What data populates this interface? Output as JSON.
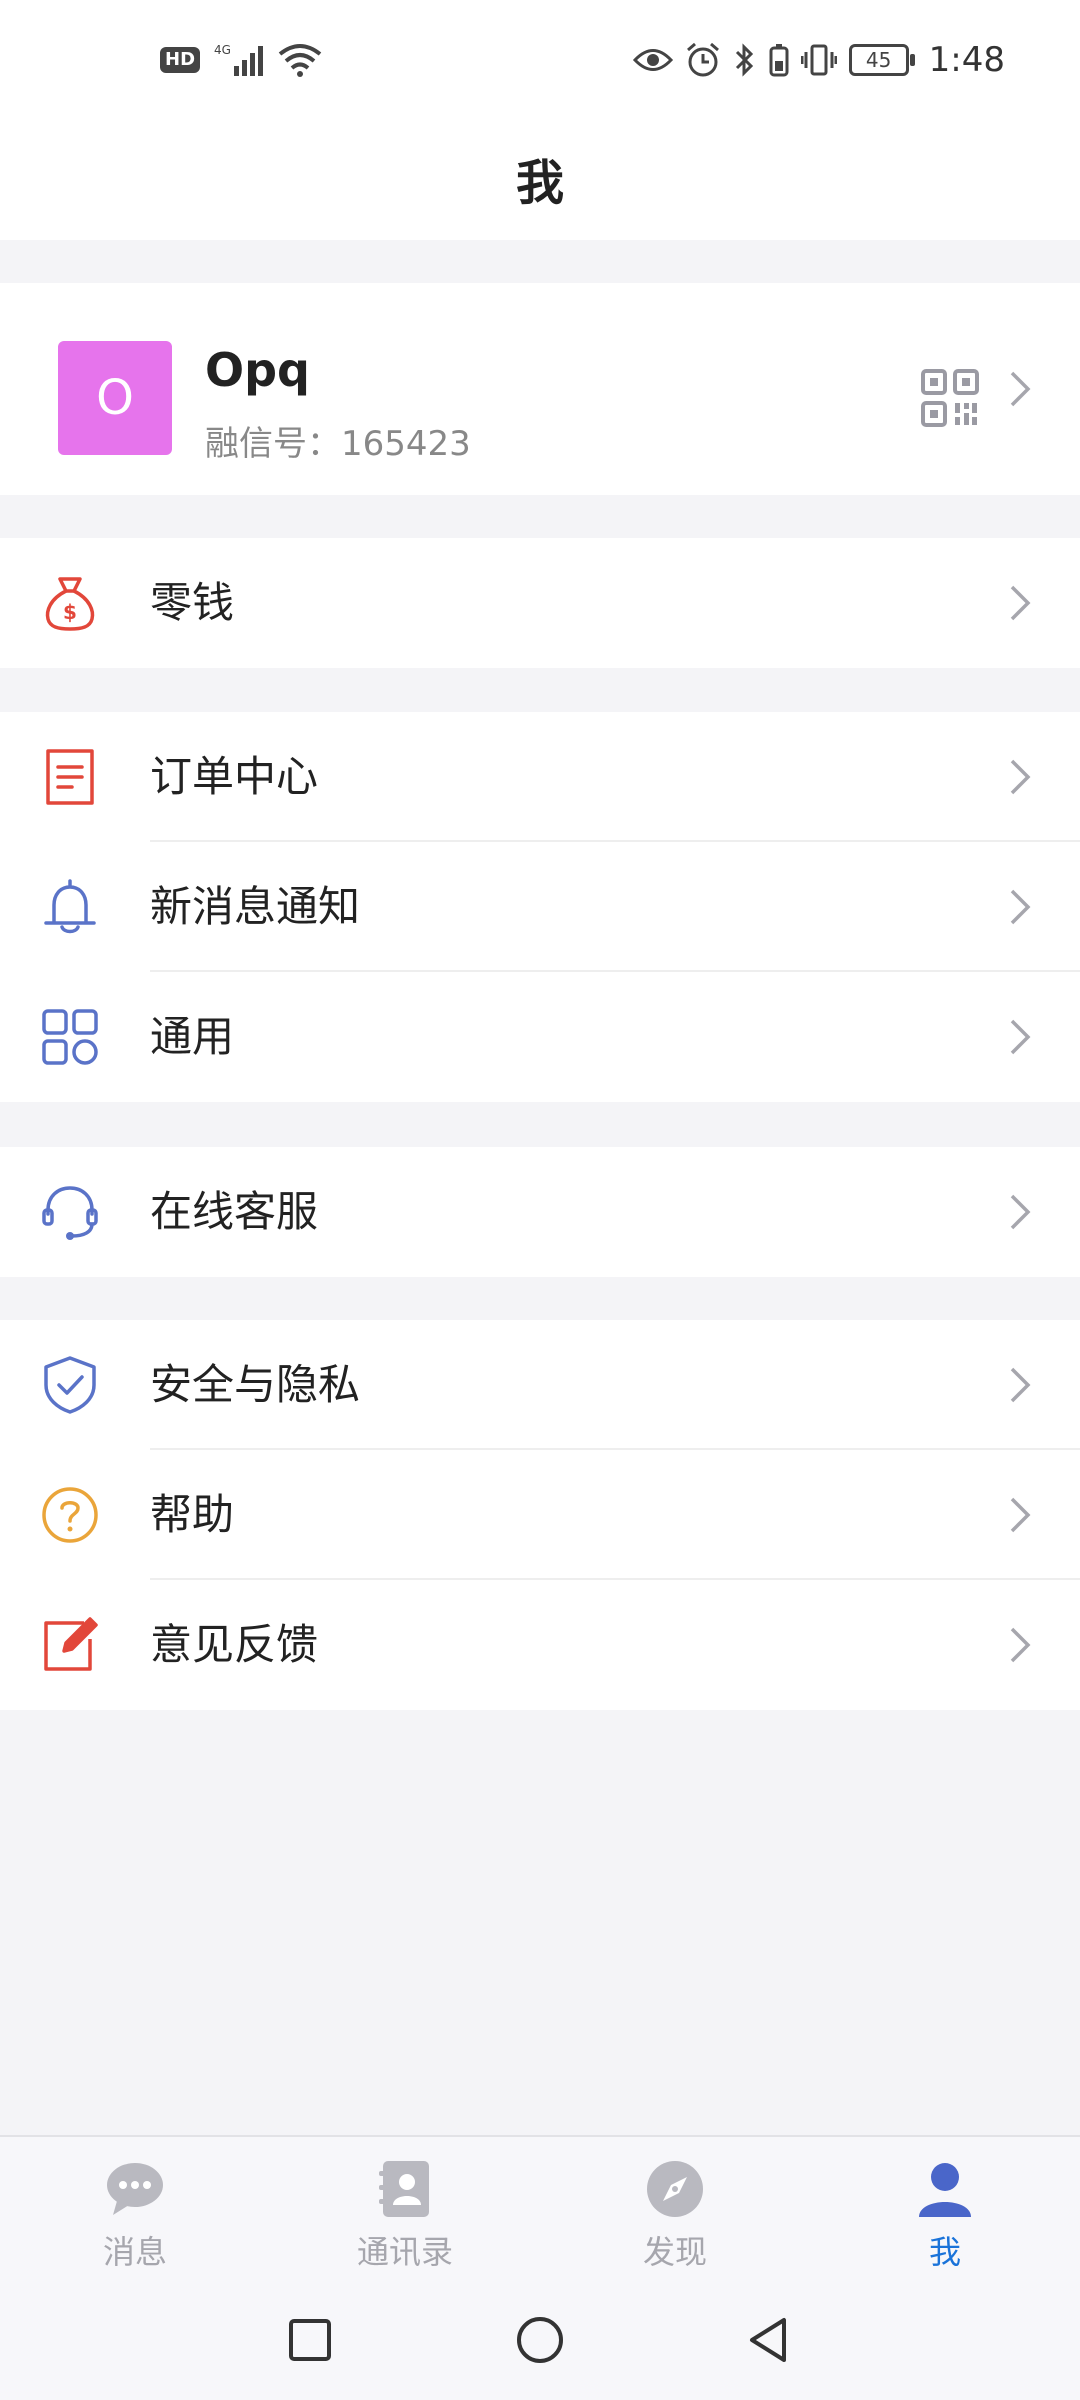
{
  "status_bar": {
    "hd": "HD",
    "network": "4G",
    "battery": "45",
    "time": "1:48"
  },
  "header": {
    "title": "我"
  },
  "profile": {
    "avatar_letter": "O",
    "name": "Opq",
    "id_label": "融信号：165423"
  },
  "menu": {
    "wallet": "零钱",
    "orders": "订单中心",
    "notifications": "新消息通知",
    "general": "通用",
    "support": "在线客服",
    "security": "安全与隐私",
    "help": "帮助",
    "feedback": "意见反馈"
  },
  "bottom_nav": {
    "messages": "消息",
    "contacts": "通讯录",
    "discover": "发现",
    "me": "我"
  },
  "colors": {
    "accent": "#1a73d9",
    "avatar_bg": "#e674ec",
    "icon_red": "#e2473a",
    "icon_blue": "#5a73c8",
    "icon_orange": "#eaa53a"
  }
}
